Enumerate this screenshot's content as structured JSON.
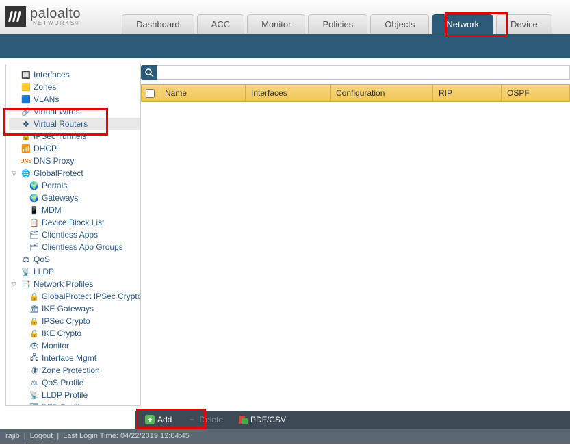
{
  "brand": {
    "main": "paloalto",
    "sub": "NETWORKS®"
  },
  "tabs": [
    {
      "label": "Dashboard"
    },
    {
      "label": "ACC"
    },
    {
      "label": "Monitor"
    },
    {
      "label": "Policies"
    },
    {
      "label": "Objects"
    },
    {
      "label": "Network"
    },
    {
      "label": "Device"
    }
  ],
  "sidebar": {
    "interfaces": "Interfaces",
    "zones": "Zones",
    "vlans": "VLANs",
    "virtualwires": "Virtual Wires",
    "virtualrouters": "Virtual Routers",
    "ipsectunnels": "IPSec Tunnels",
    "dhcp": "DHCP",
    "dnsproxy": "DNS Proxy",
    "globalprotect": "GlobalProtect",
    "portals": "Portals",
    "gateways": "Gateways",
    "mdm": "MDM",
    "deviceblocklist": "Device Block List",
    "clientlessapps": "Clientless Apps",
    "clientlessappgroups": "Clientless App Groups",
    "qos": "QoS",
    "lldp": "LLDP",
    "networkprofiles": "Network Profiles",
    "gpipseccrypto": "GlobalProtect IPSec Crypto",
    "ikegateways": "IKE Gateways",
    "ipseccrypto": "IPSec Crypto",
    "ikecrypto": "IKE Crypto",
    "monitor": "Monitor",
    "ifmgmt": "Interface Mgmt",
    "zoneprotection": "Zone Protection",
    "qosprofile": "QoS Profile",
    "lldpprofile": "LLDP Profile",
    "bfdprofile": "BFD Profile"
  },
  "columns": {
    "name": "Name",
    "interfaces": "Interfaces",
    "configuration": "Configuration",
    "rip": "RIP",
    "ospf": "OSPF"
  },
  "actions": {
    "add": "Add",
    "delete": "Delete",
    "pdfcsv": "PDF/CSV"
  },
  "status": {
    "user": "rajib",
    "logout": "Logout",
    "lastlogin": "Last Login Time: 04/22/2019 12:04:45"
  }
}
